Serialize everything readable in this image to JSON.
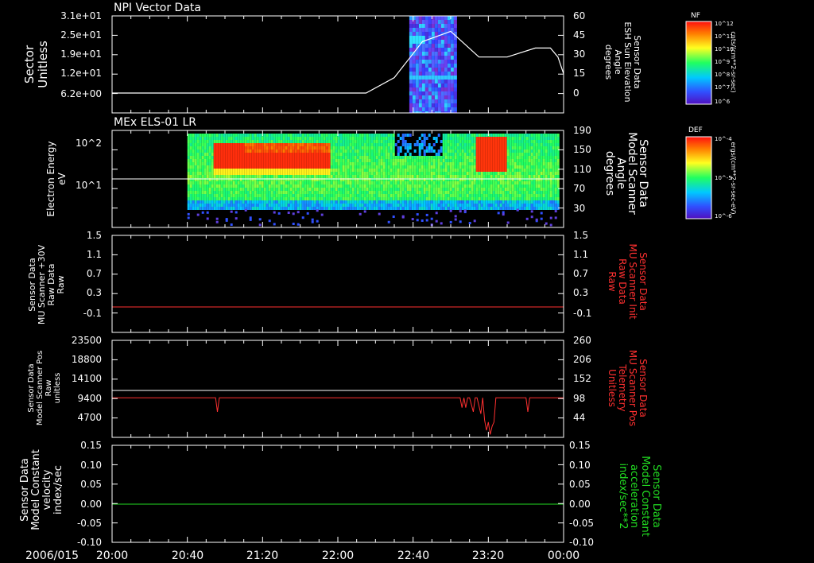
{
  "date_label": "2006/015",
  "x_ticks": [
    "20:00",
    "20:40",
    "21:20",
    "22:00",
    "22:40",
    "23:20",
    "00:00"
  ],
  "panels": [
    {
      "id": "npi",
      "title": "NPI Vector Data",
      "left_label": [
        "Sector",
        "Unitless"
      ],
      "left_ticks": [
        "3.1e+01",
        "2.5e+01",
        "1.9e+01",
        "1.2e+01",
        "6.2e+00"
      ],
      "right_label": [
        "Sensor Data",
        "ESH Sun Elevation",
        "Angle",
        "degrees"
      ],
      "right_ticks": [
        "60",
        "45",
        "30",
        "15",
        "0"
      ],
      "colorbar": {
        "title": "NF",
        "units": "cnts/(cm**2-sr-sec)",
        "ticks": [
          "10^12",
          "10^11",
          "10^10",
          "10^9",
          "10^8",
          "10^7",
          "10^6"
        ]
      }
    },
    {
      "id": "els",
      "title": "MEx ELS-01 LR",
      "left_label": [
        "Electron Energy",
        "eV"
      ],
      "left_ticks": [
        "10^2",
        "10^1"
      ],
      "right_label": [
        "Sensor Data",
        "Model Scanner",
        "Angle",
        "degrees"
      ],
      "right_ticks": [
        "190",
        "150",
        "110",
        "70",
        "30"
      ],
      "colorbar": {
        "title": "DEF",
        "units": "ergs/(cm**2-sr-sec-eV)",
        "ticks": [
          "10^-4",
          "10^-5",
          "10^-6"
        ]
      }
    },
    {
      "id": "mu_raw",
      "left_label": [
        "Sensor Data",
        "MU Scanner +30V",
        "Raw Data",
        "Raw"
      ],
      "left_ticks": [
        "1.5",
        "1.1",
        "0.7",
        "0.3",
        "-0.1"
      ],
      "right_label": [
        "Sensor Data",
        "MU Scanner Init",
        "Raw Data",
        "Raw"
      ],
      "right_ticks": [
        "1.5",
        "1.1",
        "0.7",
        "0.3",
        "-0.1"
      ]
    },
    {
      "id": "scanner_pos",
      "left_label": [
        "Sensor Data",
        "Model Scanner Pos",
        "Raw",
        "unitless"
      ],
      "left_ticks": [
        "23500",
        "18800",
        "14100",
        "9400",
        "4700"
      ],
      "right_label": [
        "Sensor Data",
        "MU Scanner Pos",
        "Telemetry",
        "Unitless"
      ],
      "right_ticks": [
        "260",
        "206",
        "152",
        "98",
        "44"
      ]
    },
    {
      "id": "constant",
      "left_label": [
        "Sensor Data",
        "Model Constant",
        "velocity",
        "index/sec"
      ],
      "left_ticks": [
        "0.15",
        "0.10",
        "0.05",
        "0.00",
        "-0.05",
        "-0.10"
      ],
      "right_label": [
        "Sensor Data",
        "Model Constant",
        "acceleration",
        "index/sec**2"
      ],
      "right_ticks": [
        "0.15",
        "0.10",
        "0.05",
        "0.00",
        "-0.05",
        "-0.10"
      ]
    }
  ],
  "chart_data": [
    {
      "type": "line",
      "title": "NPI Vector Data",
      "x_range": [
        "20:00",
        "00:00"
      ],
      "series": [
        {
          "color": "#ffffff",
          "x": [
            "20:00",
            "21:00",
            "22:00",
            "22:15",
            "22:30",
            "22:45",
            "23:00",
            "23:15",
            "23:30",
            "23:45",
            "23:53",
            "23:57",
            "00:00"
          ],
          "y": [
            0,
            0,
            0,
            0,
            12,
            40,
            48,
            28,
            28,
            35,
            35,
            28,
            15
          ]
        }
      ],
      "spectrogram_time_range": [
        "22:38",
        "23:03"
      ],
      "ylim_left": [
        6.2,
        31
      ],
      "ylim_right": [
        0,
        60
      ]
    },
    {
      "type": "heatmap",
      "title": "MEx ELS-01 LR",
      "x_range": [
        "20:00",
        "00:00"
      ],
      "data_time_range": [
        "20:40",
        "23:57"
      ],
      "ylim_left_eV": [
        1,
        200
      ],
      "y_scale": "log",
      "white_line_value_eV": 14
    },
    {
      "type": "line",
      "ylim": [
        -0.3,
        1.5
      ],
      "series": [
        {
          "color": "#ff3030",
          "x": [
            "20:00",
            "00:00"
          ],
          "y": [
            0.05,
            0.05
          ]
        }
      ]
    },
    {
      "type": "line",
      "ylim_left": [
        0,
        23500
      ],
      "ylim_right": [
        0,
        260
      ],
      "series": [
        {
          "color": "#ffffff",
          "x": [
            "20:00",
            "00:00"
          ],
          "y": [
            13000,
            13000
          ]
        },
        {
          "color": "#ff3030",
          "x": [
            "20:00",
            "20:55",
            "20:56",
            "20:57",
            "23:05",
            "23:06",
            "23:07",
            "23:08",
            "23:09",
            "23:10",
            "23:12",
            "23:13",
            "23:14",
            "23:16",
            "23:17",
            "23:18",
            "23:19",
            "23:20",
            "23:21",
            "23:22",
            "23:23",
            "23:24",
            "23:25",
            "23:40",
            "23:41",
            "23:42",
            "00:00"
          ],
          "y": [
            9400,
            9400,
            6000,
            9400,
            9400,
            7000,
            9400,
            7000,
            9400,
            9400,
            6000,
            9400,
            9400,
            5500,
            9400,
            4000,
            1500,
            3500,
            500,
            2500,
            3500,
            9400,
            9400,
            9400,
            6000,
            9400,
            9400
          ]
        }
      ]
    },
    {
      "type": "line",
      "ylim": [
        -0.1,
        0.15
      ],
      "series": [
        {
          "color": "#22dd22",
          "x": [
            "20:00",
            "00:00"
          ],
          "y": [
            0.0,
            0.0
          ]
        }
      ]
    }
  ]
}
